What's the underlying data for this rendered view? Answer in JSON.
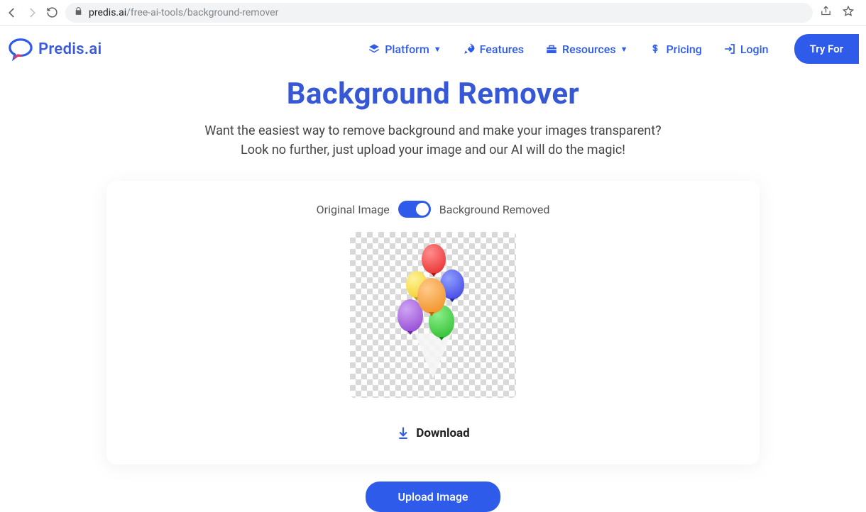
{
  "browser": {
    "url_domain": "predis.ai",
    "url_path": "/free-ai-tools/background-remover"
  },
  "header": {
    "brand": "Predis.ai",
    "nav": {
      "platform": "Platform",
      "features": "Features",
      "resources": "Resources",
      "pricing": "Pricing",
      "login": "Login",
      "try": "Try For "
    }
  },
  "hero": {
    "title": "Background Remover",
    "line1": "Want the easiest way to remove background and make your images transparent?",
    "line2": "Look no further, just upload your image and our AI will do the magic!"
  },
  "card": {
    "toggle_left": "Original Image",
    "toggle_right": "Background Removed",
    "download": "Download"
  },
  "actions": {
    "upload": "Upload Image"
  }
}
